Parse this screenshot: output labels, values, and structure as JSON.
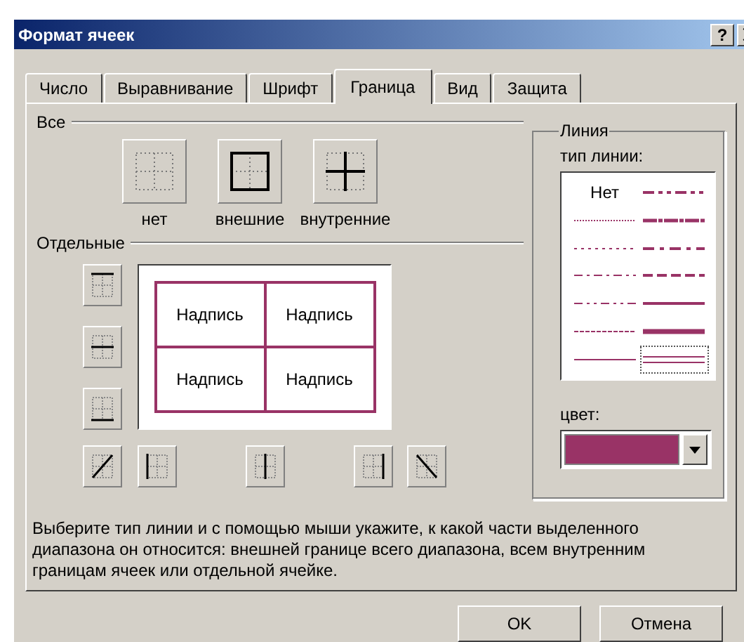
{
  "window": {
    "title": "Формат ячеек",
    "help_button": "?"
  },
  "tabs": [
    {
      "label": "Число",
      "selected": false
    },
    {
      "label": "Выравнивание",
      "selected": false
    },
    {
      "label": "Шрифт",
      "selected": false
    },
    {
      "label": "Граница",
      "selected": true
    },
    {
      "label": "Вид",
      "selected": false
    },
    {
      "label": "Защита",
      "selected": false
    }
  ],
  "presets": {
    "heading": "Все",
    "items": [
      {
        "kind": "none",
        "label": "нет"
      },
      {
        "kind": "outline",
        "label": "внешние"
      },
      {
        "kind": "inside",
        "label": "внутренние"
      }
    ]
  },
  "border": {
    "heading": "Отдельные",
    "cells": [
      "Надпись",
      "Надпись",
      "Надпись",
      "Надпись"
    ]
  },
  "line": {
    "heading": "Линия",
    "style_label": "тип линии:",
    "styles": [
      {
        "kind": "none",
        "text": "Нет",
        "selected": false
      },
      {
        "kind": "hair",
        "selected": false
      },
      {
        "kind": "dotted",
        "selected": false
      },
      {
        "kind": "dash-dot",
        "selected": false
      },
      {
        "kind": "dash-dot-dot",
        "selected": false
      },
      {
        "kind": "dashed",
        "selected": false
      },
      {
        "kind": "thin",
        "selected": false
      },
      {
        "kind": "medium-dash-dot-dot",
        "selected": false
      },
      {
        "kind": "slant-dash-dot",
        "selected": false
      },
      {
        "kind": "medium-dash-dot",
        "selected": false
      },
      {
        "kind": "medium-dashed",
        "selected": false
      },
      {
        "kind": "medium",
        "selected": false
      },
      {
        "kind": "thick",
        "selected": false
      },
      {
        "kind": "double",
        "selected": true
      }
    ],
    "color_label": "цвет:",
    "color": "#993366"
  },
  "help_text": "Выберите тип линии и с помощью мыши укажите, к какой части выделенного диапазона он относится: внешней границе всего диапазона, всем внутренним границам ячеек или отдельной ячейке.",
  "buttons": [
    "OK",
    "Отмена"
  ]
}
